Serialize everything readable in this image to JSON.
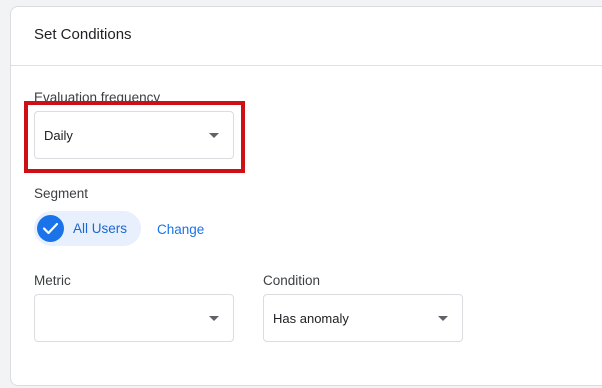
{
  "card": {
    "title": "Set Conditions"
  },
  "evaluation": {
    "label": "Evaluation frequency",
    "value": "Daily"
  },
  "segment": {
    "label": "Segment",
    "chip_label": "All Users",
    "change_label": "Change"
  },
  "metric": {
    "label": "Metric",
    "value": ""
  },
  "condition": {
    "label": "Condition",
    "value": "Has anomaly"
  },
  "colors": {
    "highlight": "#cc1016",
    "accent": "#1a73e8",
    "chip_bg": "#e8f0fe"
  },
  "icons": {
    "chip": "check-icon",
    "select": "dropdown-arrow-icon"
  }
}
